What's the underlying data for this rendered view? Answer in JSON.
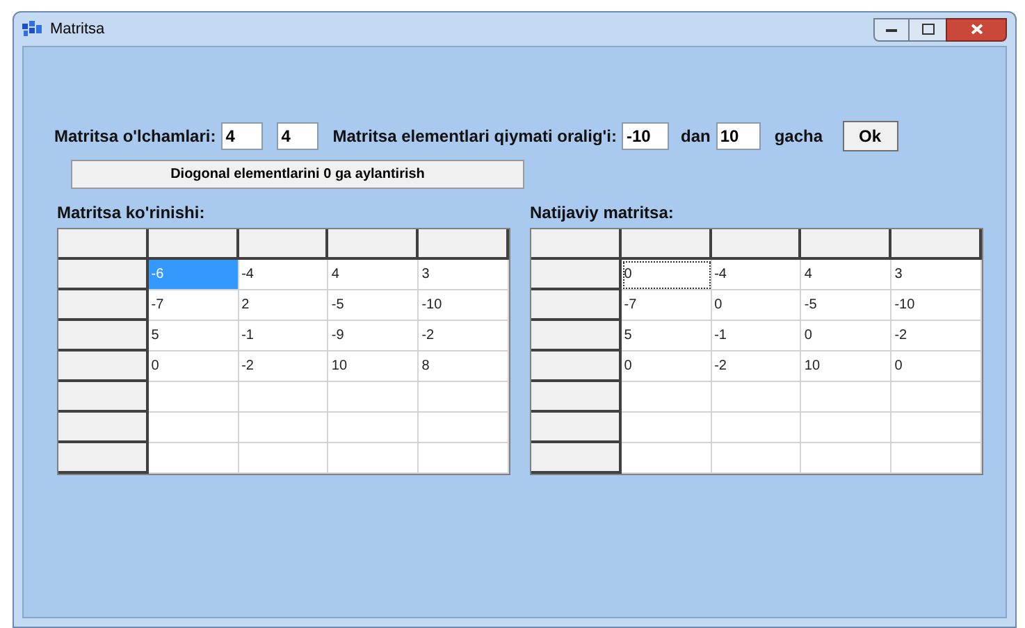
{
  "window": {
    "title": "Matritsa"
  },
  "toolbar": {
    "size_label": "Matritsa o'lchamlari:",
    "rows_value": "4",
    "cols_value": "4",
    "range_label": "Matritsa elementlari qiymati oralig'i:",
    "min_value": "-10",
    "from_label": "dan",
    "max_value": "10",
    "to_label": "gacha",
    "ok_button": "Ok"
  },
  "action_button": "Diogonal elementlarini 0 ga aylantirish",
  "grids": [
    {
      "title": "Matritsa ko'rinishi:",
      "rows": [
        [
          {
            "value": "-6",
            "selected": true
          },
          {
            "value": "-4",
            "selected": false
          },
          {
            "value": "4",
            "selected": false
          },
          {
            "value": "3",
            "selected": false
          }
        ],
        [
          {
            "value": "-7",
            "selected": false
          },
          {
            "value": "2",
            "selected": false
          },
          {
            "value": "-5",
            "selected": false
          },
          {
            "value": "-10",
            "selected": false
          }
        ],
        [
          {
            "value": "5",
            "selected": false
          },
          {
            "value": "-1",
            "selected": false
          },
          {
            "value": "-9",
            "selected": false
          },
          {
            "value": "-2",
            "selected": false
          }
        ],
        [
          {
            "value": "0",
            "selected": false
          },
          {
            "value": "-2",
            "selected": false
          },
          {
            "value": "10",
            "selected": false
          },
          {
            "value": "8",
            "selected": false
          }
        ]
      ]
    },
    {
      "title": "Natijaviy matritsa:",
      "rows": [
        [
          {
            "value": "0",
            "focused": true
          },
          {
            "value": "-4",
            "focused": false
          },
          {
            "value": "4",
            "focused": false
          },
          {
            "value": "3",
            "focused": false
          }
        ],
        [
          {
            "value": "-7",
            "focused": false
          },
          {
            "value": "0",
            "focused": false
          },
          {
            "value": "-5",
            "focused": false
          },
          {
            "value": "-10",
            "focused": false
          }
        ],
        [
          {
            "value": "5",
            "focused": false
          },
          {
            "value": "-1",
            "focused": false
          },
          {
            "value": "0",
            "focused": false
          },
          {
            "value": "-2",
            "focused": false
          }
        ],
        [
          {
            "value": "0",
            "focused": false
          },
          {
            "value": "-2",
            "focused": false
          },
          {
            "value": "10",
            "focused": false
          },
          {
            "value": "0",
            "focused": false
          }
        ]
      ]
    }
  ]
}
